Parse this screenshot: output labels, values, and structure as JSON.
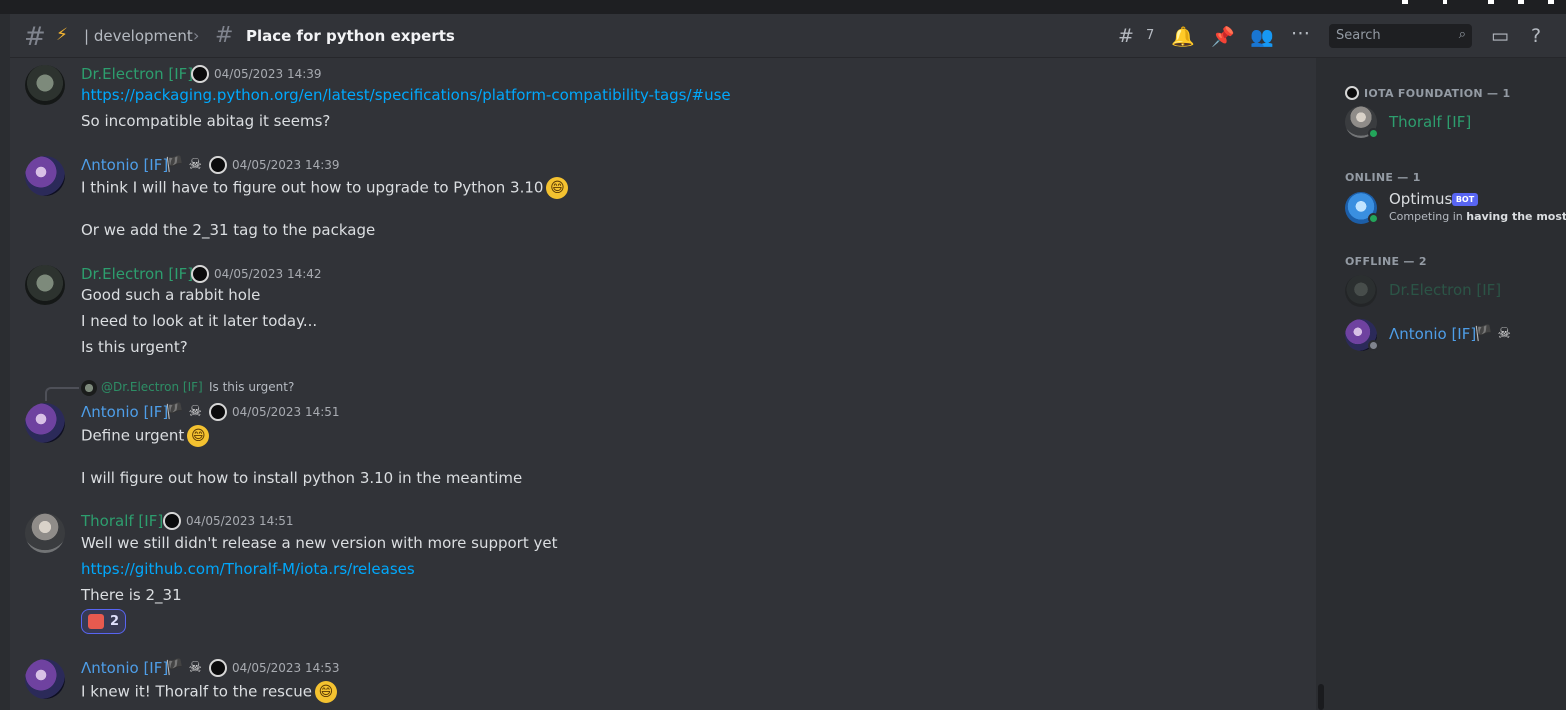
{
  "header": {
    "hash_icon": "channel-hash-icon",
    "bolt_emoji": "⚡",
    "channel_name": "| development",
    "thread_icon": "thread-icon",
    "thread_title": "Place for python experts",
    "threads_count": "7",
    "search_placeholder": "Search"
  },
  "messages": [
    {
      "author": "Dr.Electron [IF]",
      "timestamp": "04/05/2023 14:39",
      "lines": [
        "https://packaging.python.org/en/latest/specifications/platform-compatibility-tags/#use",
        "So incompatible abitag it seems?"
      ]
    },
    {
      "author": "Λntonio [IF]",
      "flags": "🏴 ☠",
      "timestamp": "04/05/2023 14:39",
      "lines": [
        "I think I will have to figure out how to upgrade to Python 3.10",
        "Or we add the 2_31 tag to the package"
      ]
    },
    {
      "author": "Dr.Electron [IF]",
      "timestamp": "04/05/2023 14:42",
      "lines": [
        "Good such a rabbit hole",
        "I need to look at it later today...",
        "Is this urgent?"
      ]
    },
    {
      "reply": {
        "author": "@Dr.Electron [IF]",
        "text": "Is this urgent?"
      },
      "author": "Λntonio [IF]",
      "flags": "🏴 ☠",
      "timestamp": "04/05/2023 14:51",
      "lines": [
        "Define urgent",
        "I will figure out how to install python 3.10 in the meantime"
      ]
    },
    {
      "author": "Thoralf [IF]",
      "timestamp": "04/05/2023 14:51",
      "lines": [
        "Well we still didn't release a new version with more support yet",
        "https://github.com/Thoralf-M/iota.rs/releases",
        "There is 2_31"
      ],
      "reaction_count": "2"
    },
    {
      "author": "Λntonio [IF]",
      "flags": "🏴 ☠",
      "timestamp": "04/05/2023 14:53",
      "lines": [
        "I knew it! Thoralf to the rescue"
      ]
    }
  ],
  "emoji": {
    "smile": "😄"
  },
  "members": {
    "sections": [
      {
        "label": "IOTA FOUNDATION — 1"
      },
      {
        "label": "ONLINE — 1"
      },
      {
        "label": "OFFLINE — 2"
      }
    ],
    "list": [
      {
        "name": "Thoralf [IF]",
        "status": "online"
      },
      {
        "name": "Optimus",
        "bot_tag": "BOT",
        "activity_prefix": "Competing in ",
        "activity_bold": "having the most...",
        "status": "online"
      },
      {
        "name": "Dr.Electron [IF]",
        "status": "offline"
      },
      {
        "name": "Λntonio [IF]",
        "flags": "🏴 ☠",
        "status": "offline"
      }
    ]
  },
  "colors": {
    "background": "#313338",
    "sidebar": "#2b2d31",
    "link": "#00a8fc",
    "role_green": "#2d9e6e",
    "role_blue": "#4e9ee8",
    "online": "#23a55a"
  }
}
